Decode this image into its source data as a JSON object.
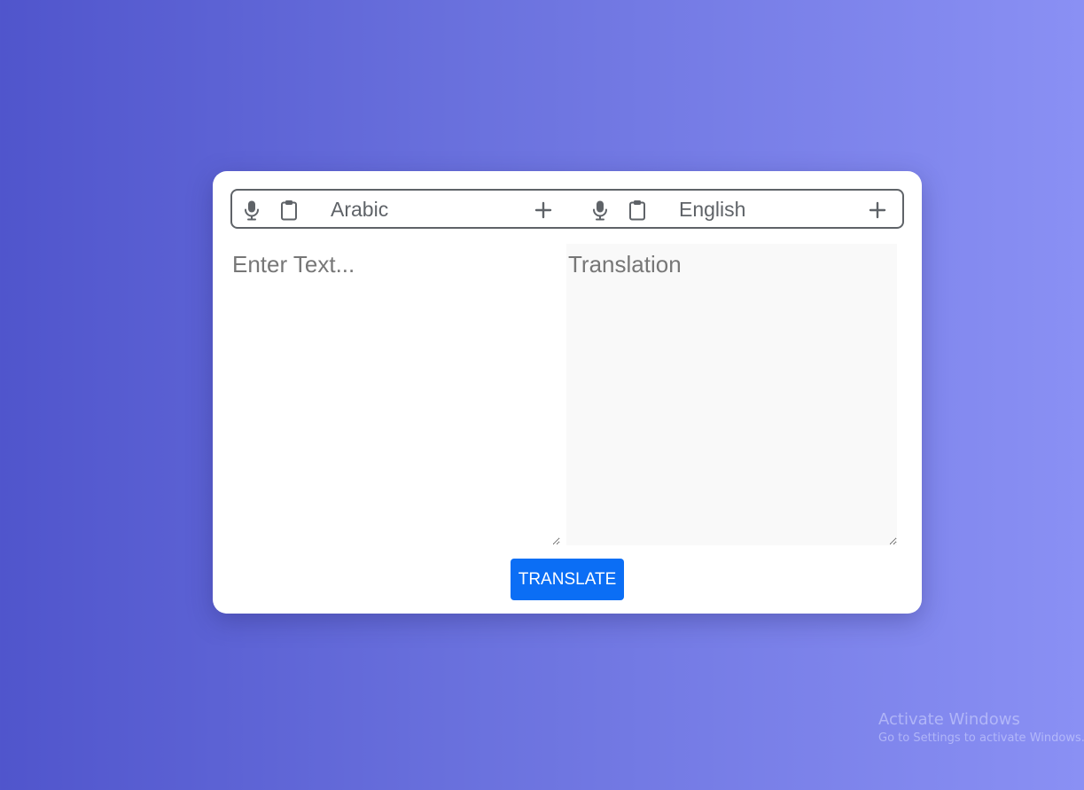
{
  "translator": {
    "from": {
      "language": "Arabic",
      "mic_icon": "microphone-icon",
      "copy_icon": "clipboard-icon",
      "add_icon": "plus-icon",
      "placeholder": "Enter Text..."
    },
    "to": {
      "language": "English",
      "mic_icon": "microphone-icon",
      "copy_icon": "clipboard-icon",
      "add_icon": "plus-icon",
      "placeholder": "Translation"
    },
    "translate_label": "TRANSLATE"
  },
  "watermark": {
    "title": "Activate Windows",
    "subtitle": "Go to Settings to activate Windows."
  },
  "colors": {
    "background_start": "#5055cc",
    "background_end": "#8a90f4",
    "button": "#0b6ef5",
    "icon": "#5f6368",
    "output_bg": "#f9f9f9"
  }
}
